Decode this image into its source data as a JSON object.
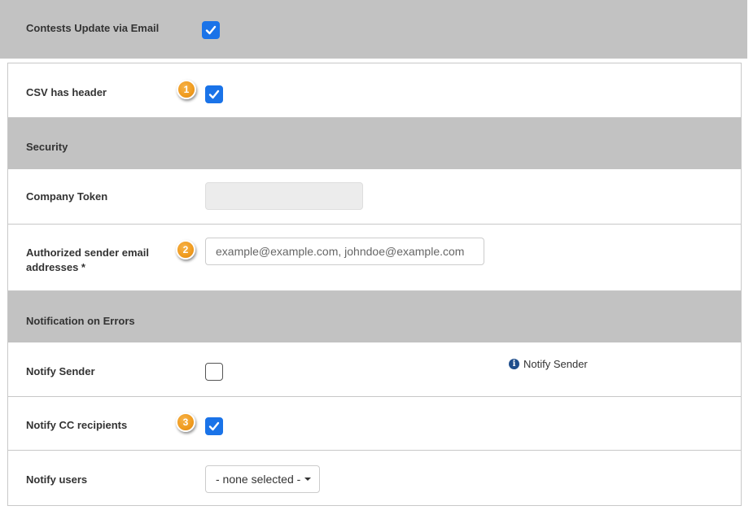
{
  "contests_update": {
    "label": "Contests Update via Email",
    "checked": true
  },
  "csv_header": {
    "label": "CSV has header",
    "checked": true,
    "marker": "1"
  },
  "security": {
    "section_title": "Security",
    "company_token_label": "Company Token",
    "authorized_label_line1": "Authorized sender email",
    "authorized_label_line2": "addresses *",
    "authorized_placeholder": "example@example.com, johndoe@example.com",
    "marker": "2"
  },
  "notifications": {
    "section_title": "Notification on Errors",
    "notify_sender": {
      "label": "Notify Sender",
      "checked": false,
      "info_text": "Notify Sender",
      "info_icon": "info-circle-icon"
    },
    "notify_cc": {
      "label": "Notify CC recipients",
      "checked": true,
      "marker": "3"
    },
    "notify_users": {
      "label": "Notify users",
      "select_value": "- none selected -"
    }
  },
  "colors": {
    "checkbox_blue": "#1a73e8",
    "header_gray": "#c2c2c2",
    "marker_orange": "#f09b1e",
    "info_blue": "#1f4e8c"
  }
}
